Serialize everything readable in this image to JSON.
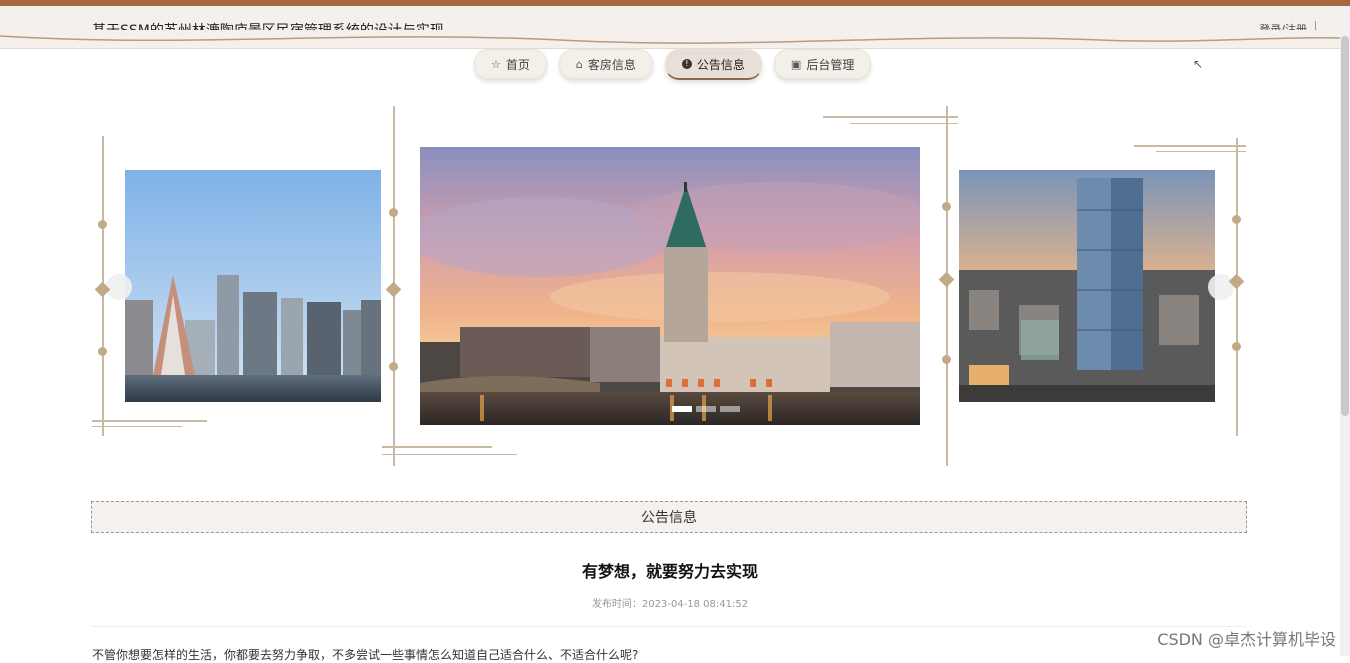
{
  "header": {
    "title": "基于SSM的苏州林漉陶庐景区民宿管理系统的设计与实现",
    "login": "登录/注册"
  },
  "nav": [
    {
      "label": "首页",
      "icon": "star-icon",
      "active": false
    },
    {
      "label": "客房信息",
      "icon": "bag-icon",
      "active": false
    },
    {
      "label": "公告信息",
      "icon": "info-icon",
      "active": true
    },
    {
      "label": "后台管理",
      "icon": "clipboard-icon",
      "active": false
    }
  ],
  "carousel": {
    "slides": [
      "city-skyline-image",
      "church-sunset-image",
      "skyscraper-image"
    ],
    "active_index": 1,
    "dot_count": 3
  },
  "notice": {
    "section_title": "公告信息",
    "article_title": "有梦想，就要努力去实现",
    "publish_label": "发布时间：",
    "publish_time": "2023-04-18 08:41:52",
    "body": "不管你想要怎样的生活，你都要去努力争取，不多尝试一些事情怎么知道自己适合什么、不适合什么呢?"
  },
  "watermark": "CSDN @卓杰计算机毕设",
  "colors": {
    "accent": "#a7683f",
    "gold": "#c2aa86",
    "header_bg": "#f4f1ed"
  }
}
